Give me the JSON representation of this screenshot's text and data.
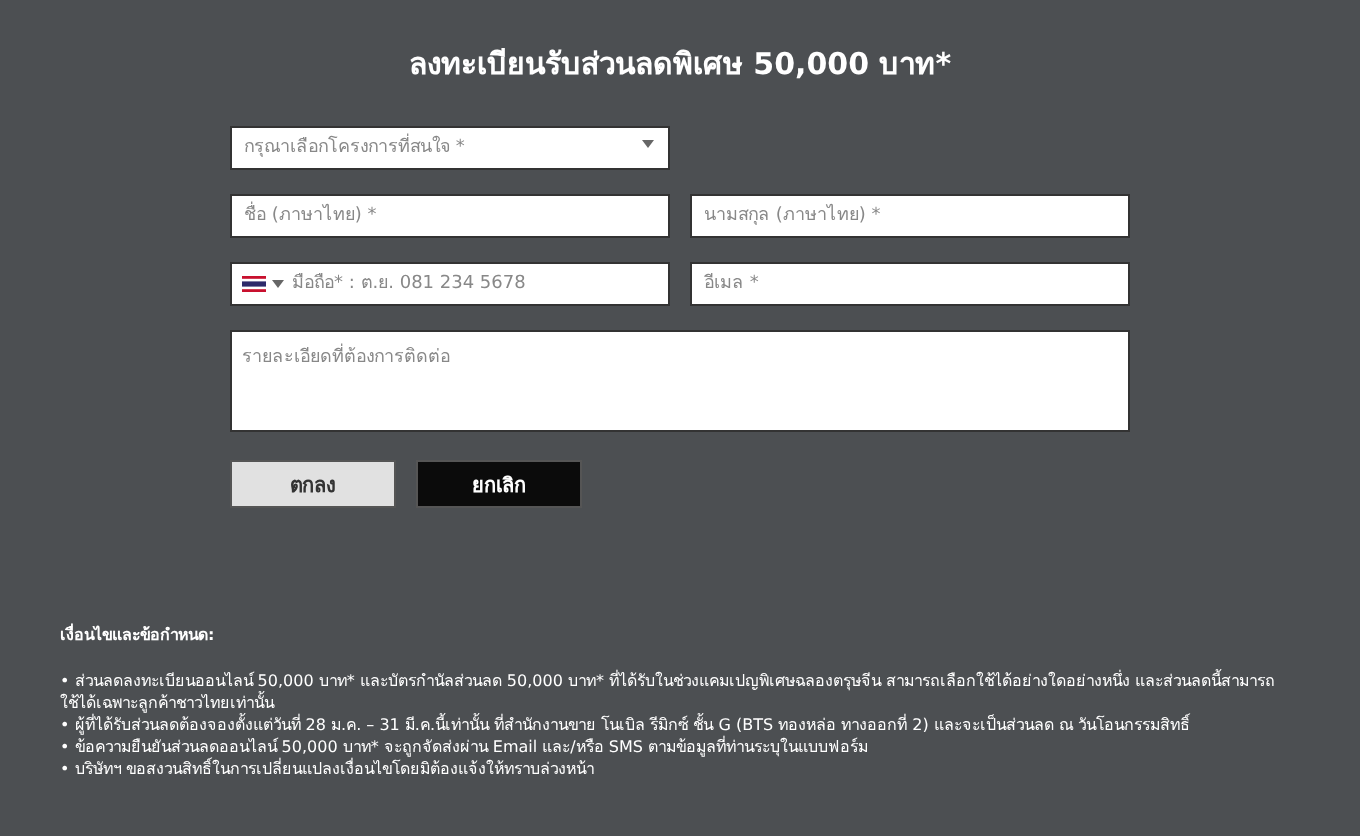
{
  "title": "ลงทะเบียนรับส่วนลดพิเศษ 50,000 บาท*",
  "project_select": {
    "placeholder": "กรุณาเลือกโครงการที่สนใจ *"
  },
  "first_name": {
    "placeholder": "ชื่อ (ภาษาไทย) *"
  },
  "last_name": {
    "placeholder": "นามสกุล (ภาษาไทย) *"
  },
  "phone": {
    "placeholder": "มือถือ* : ต.ย. 081 234 5678"
  },
  "email": {
    "placeholder": "อีเมล *"
  },
  "details": {
    "placeholder": "รายละเอียดที่ต้องการติดต่อ"
  },
  "buttons": [
    {
      "label": "ตกลง",
      "kind": "primary"
    },
    {
      "label": "ยกเลิก",
      "kind": "dark"
    }
  ],
  "terms": {
    "heading": "เงื่อนไขและข้อกำหนด:",
    "items": [
      "• ส่วนลดลงทะเบียนออนไลน์ 50,000 บาท* และบัตรกำนัลส่วนลด 50,000 บาท* ที่ได้รับในช่วงแคมเปญพิเศษฉลองตรุษจีน สามารถเลือกใช้ได้อย่างใดอย่างหนึ่ง และส่วนลดนี้สามารถใช้ได้เฉพาะลูกค้าชาวไทยเท่านั้น",
      "• ผู้ที่ได้รับส่วนลดต้องจองตั้งแต่วันที่ 28 ม.ค. – 31 มี.ค.นี้เท่านั้น ที่สำนักงานขาย โนเบิล รีมิกซ์ ชั้น G (BTS ทองหล่อ ทางออกที่ 2) และจะเป็นส่วนลด ณ วันโอนกรรมสิทธิ์",
      "• ข้อความยืนยันส่วนลดออนไลน์ 50,000 บาท* จะถูกจัดส่งผ่าน Email และ/หรือ SMS ตามข้อมูลที่ท่านระบุในแบบฟอร์ม",
      "• บริษัทฯ ขอสงวนสิทธิ์ในการเปลี่ยนแปลงเงื่อนไขโดยมิต้องแจ้งให้ทราบล่วงหน้า"
    ]
  }
}
